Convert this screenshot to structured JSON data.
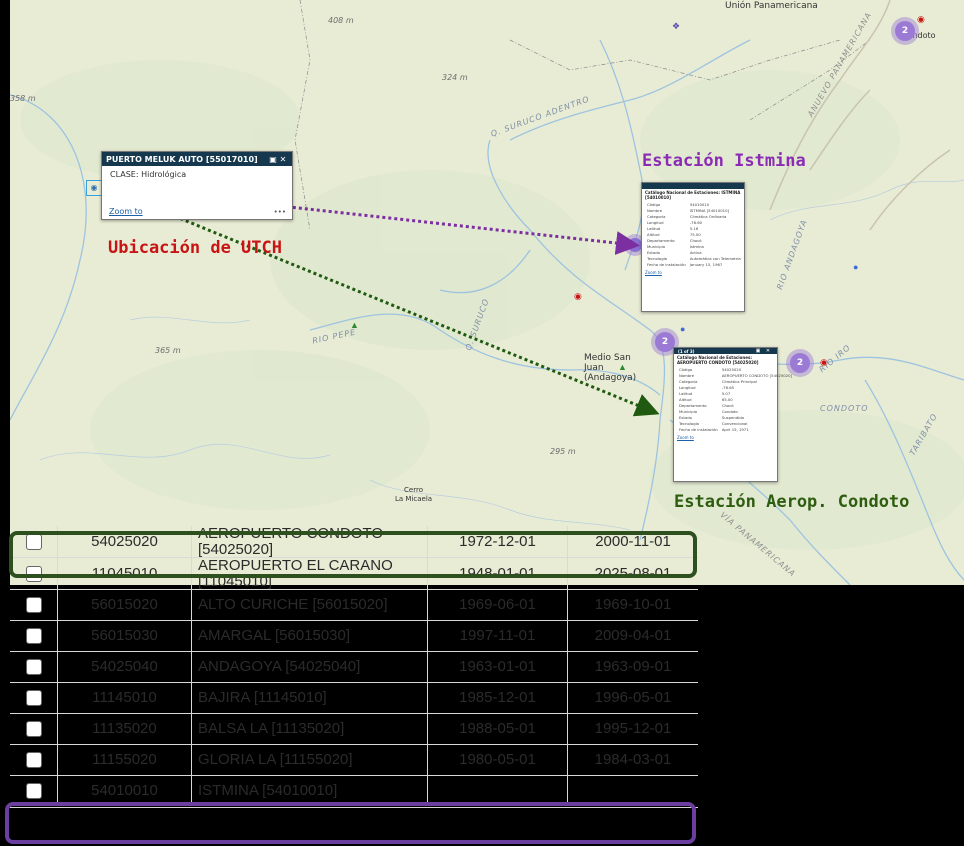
{
  "map": {
    "place_labels": {
      "union_panamericana": "Unión\nPanamericana",
      "medio_san_juan": "Medio San\nJuan (Andagoya)",
      "cerro_la_micaela": "Cerro\nLa Micaela",
      "condoto": "Condoto"
    },
    "elevation_labels": [
      "408 m",
      "324 m",
      "358 m",
      "365 m",
      "295 m"
    ],
    "river_labels": [
      "Q. SURUCO ADENTRO",
      "RIO PEPE",
      "Q. SURUCO",
      "RIO IRO",
      "CONDOTO",
      "TARIBATO",
      "RIO ANDAGOYA"
    ],
    "road_labels": [
      "ANUEVO PANAMERICANA",
      "VÍA PANAMERICANA"
    ],
    "clusters": [
      {
        "id": "cluster-top-right",
        "count": "2"
      },
      {
        "id": "cluster-istmina",
        "count": "2"
      },
      {
        "id": "cluster-condoto",
        "count": "2"
      }
    ]
  },
  "popup_utch": {
    "title": "PUERTO MELUK AUTO [55017010]",
    "field_label": "CLASE:",
    "field_value": "Hidrológica",
    "zoom_label": "Zoom to",
    "more_label": "•••"
  },
  "popup_istmina": {
    "title": "Catálogo Nacional de Estaciones: ISTMINA [54010010]",
    "fields": [
      [
        "Código",
        "54010010"
      ],
      [
        "Nombre",
        "ISTMINA [54010010]"
      ],
      [
        "Categoría",
        "Climática Ordinaria"
      ],
      [
        "Longitud",
        "-76.60"
      ],
      [
        "Latitud",
        "5.16"
      ],
      [
        "Altitud",
        "75.00"
      ],
      [
        "Departamento",
        "Chocó"
      ],
      [
        "Municipio",
        "Istmina"
      ],
      [
        "Estado",
        "Activa"
      ],
      [
        "Tecnología",
        "Automática con Telemetría"
      ],
      [
        "Fecha de instalación",
        "January 15, 1967"
      ]
    ],
    "zoom_label": "Zoom to"
  },
  "popup_condoto": {
    "header": "(1 of 3)",
    "title": "Catálogo Nacional de Estaciones: AEROPUERTO CONDOTO [54025020]",
    "fields": [
      [
        "Código",
        "54025020"
      ],
      [
        "Nombre",
        "AEROPUERTO CONDOTO [54025020]"
      ],
      [
        "Categoría",
        "Climática Principal"
      ],
      [
        "Longitud",
        "-76.65"
      ],
      [
        "Latitud",
        "5.07"
      ],
      [
        "Altitud",
        "65.00"
      ],
      [
        "Departamento",
        "Chocó"
      ],
      [
        "Municipio",
        "Condoto"
      ],
      [
        "Estado",
        "Suspendida"
      ],
      [
        "Tecnología",
        "Convencional"
      ],
      [
        "Fecha de instalación",
        "April 15, 1971"
      ]
    ],
    "zoom_label": "Zoom to"
  },
  "annotations": {
    "utch": "Ubicación de UTCH",
    "istmina": "Estación Istmina",
    "condoto": "Estación Aerop. Condoto"
  },
  "colors": {
    "utch": "#c81414",
    "istmina_arrow": "#7b2fa0",
    "condoto_arrow": "#1f5a10",
    "highlight_green": "#2e4f1e",
    "highlight_purple": "#6b3fa0",
    "popup_header": "#15384e"
  },
  "table": {
    "rows": [
      {
        "code": "54025020",
        "name": "AEROPUERTO CONDOTO [54025020]",
        "start": "1972-12-01",
        "end": "2000-11-01"
      },
      {
        "code": "11045010",
        "name": "AEROPUERTO EL CARANO [11045010]",
        "start": "1948-01-01",
        "end": "2025-08-01"
      },
      {
        "code": "56015020",
        "name": "ALTO CURICHE [56015020]",
        "start": "1969-06-01",
        "end": "1969-10-01"
      },
      {
        "code": "56015030",
        "name": "AMARGAL [56015030]",
        "start": "1997-11-01",
        "end": "2009-04-01"
      },
      {
        "code": "54025040",
        "name": "ANDAGOYA [54025040]",
        "start": "1963-01-01",
        "end": "1963-09-01"
      },
      {
        "code": "11145010",
        "name": "BAJIRA [11145010]",
        "start": "1985-12-01",
        "end": "1996-05-01"
      },
      {
        "code": "11135020",
        "name": "BALSA LA [11135020]",
        "start": "1988-05-01",
        "end": "1995-12-01"
      },
      {
        "code": "11155020",
        "name": "GLORIA LA [11155020]",
        "start": "1980-05-01",
        "end": "1984-03-01"
      },
      {
        "code": "54010010",
        "name": "ISTMINA [54010010]",
        "start": "",
        "end": ""
      }
    ]
  }
}
